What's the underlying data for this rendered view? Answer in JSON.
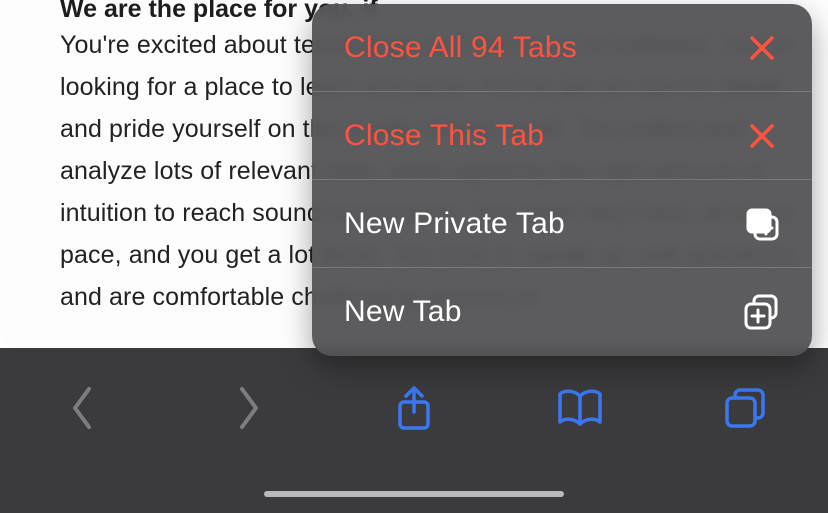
{
  "article": {
    "heading": "We are the place for you, if",
    "body": "You're excited about technology and the future of software. You're looking for a place to learn and grow. You've got an eye for detail and pride yourself on the quality of your work. You collect and analyze lots of relevant data, while applying the right amount of intuition to reach sound conclusions. You work very hard, at a fast pace, and you get a lot done. You love to speak up, ask questions, and are comfortable challenging anyone or"
  },
  "menu": {
    "closeAll": "Close All 94 Tabs",
    "closeThis": "Close This Tab",
    "newPrivate": "New Private Tab",
    "newTab": "New Tab"
  }
}
